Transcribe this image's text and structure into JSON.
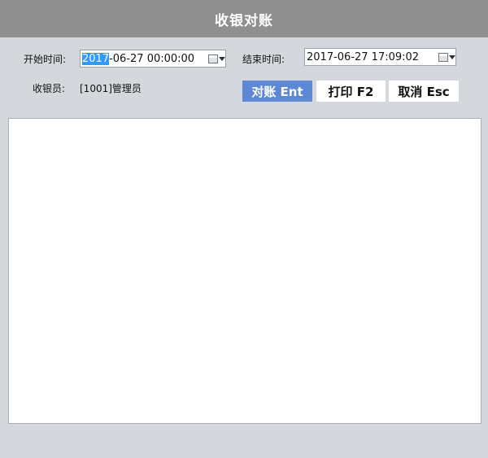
{
  "window": {
    "title": "收银对账"
  },
  "filters": {
    "start_label": "开始时间:",
    "start_value_selected": "2017",
    "start_value_rest": "-06-27 00:00:00",
    "end_label": "结束时间:",
    "end_value": "2017-06-27 17:09:02",
    "cashier_label": "收银员:",
    "cashier_value": "[1001]管理员"
  },
  "actions": {
    "reconcile_label": "对账 Ent",
    "print_label": "打印 F2",
    "cancel_label": "取消 Esc"
  },
  "icons": {
    "calendar": "calendar-icon",
    "dropdown": "chevron-down-icon"
  },
  "colors": {
    "titlebar_bg": "#8f8f8f",
    "window_bg": "#d4d8dc",
    "primary_button": "#5c88d6",
    "selection": "#3399ff"
  }
}
